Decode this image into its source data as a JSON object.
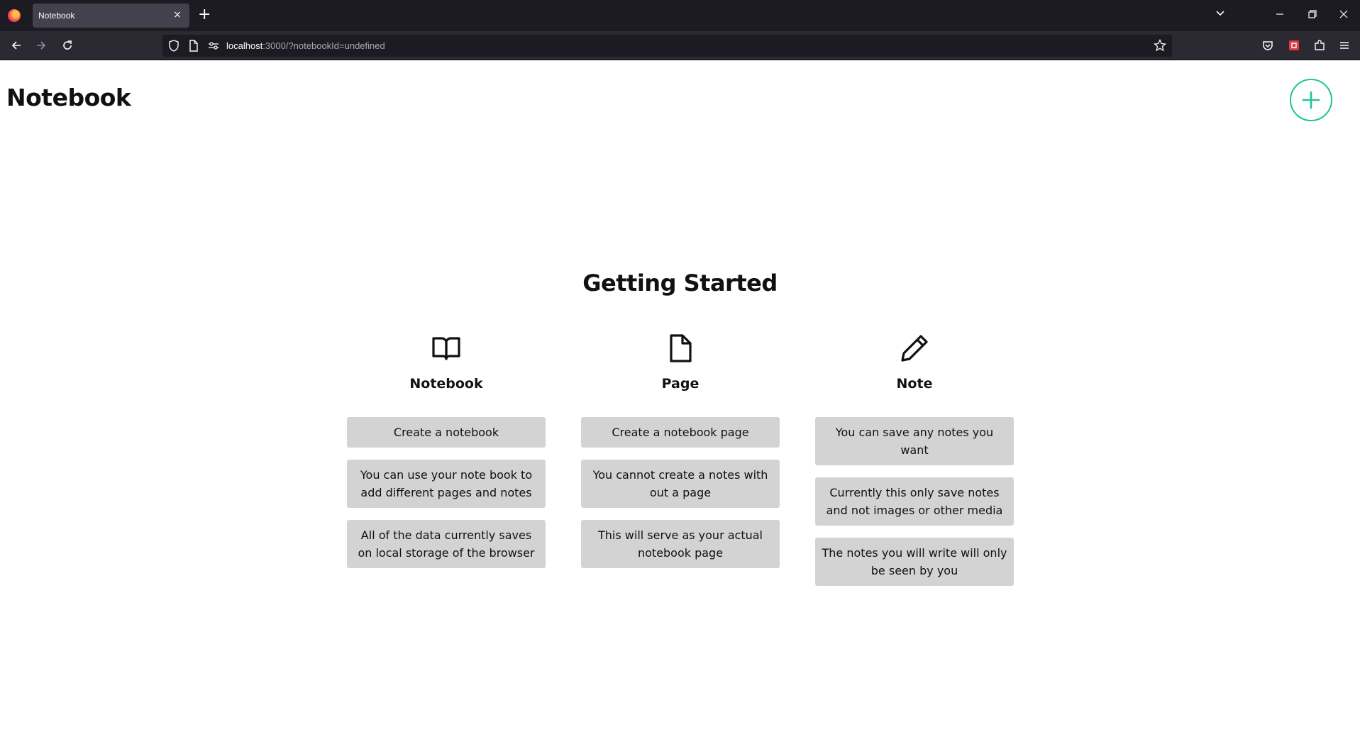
{
  "browser": {
    "tab_title": "Notebook",
    "tab_close": "×",
    "new_tab": "+",
    "url_host": "localhost",
    "url_rest": ":3000/?notebookId=undefined"
  },
  "header": {
    "title": "Notebook"
  },
  "getting_started": {
    "title": "Getting Started",
    "columns": [
      {
        "icon": "book-open-icon",
        "heading": "Notebook",
        "cards": [
          "Create a notebook",
          "You can use your note book to add different pages and notes",
          "All of the data currently saves on local storage of the browser"
        ]
      },
      {
        "icon": "file-icon",
        "heading": "Page",
        "cards": [
          "Create a notebook page",
          "You cannot create a notes with out a page",
          "This will serve as your actual notebook page"
        ]
      },
      {
        "icon": "pencil-icon",
        "heading": "Note",
        "cards": [
          "You can save any notes you want",
          "Currently this only save notes and not images or other media",
          "The notes you will write will only be seen by you"
        ]
      }
    ]
  },
  "colors": {
    "accent": "#21c29b",
    "card_bg": "#d3d3d3",
    "chrome_bg": "#1c1b22"
  }
}
